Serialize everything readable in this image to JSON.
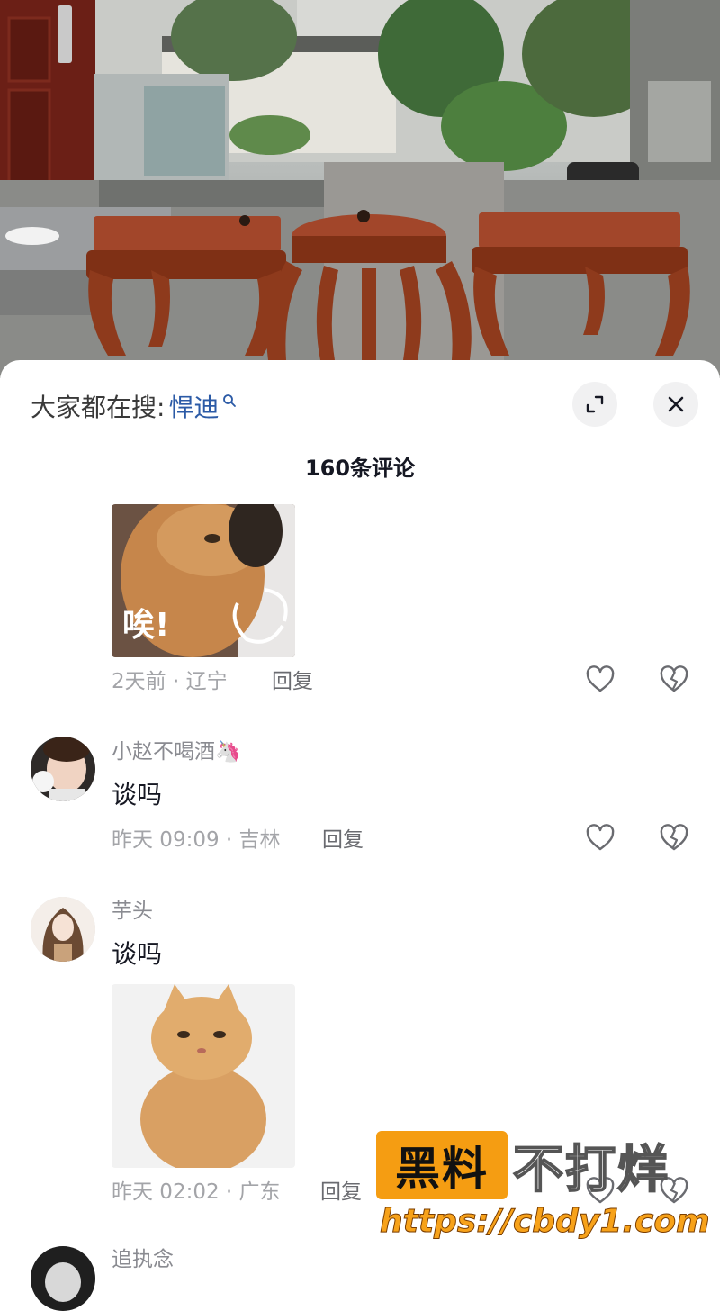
{
  "header": {
    "search_prefix": "大家都在搜:",
    "search_term": "悍迪",
    "comment_count": "160条评论"
  },
  "comments": [
    {
      "sticker_caption": "唉!",
      "meta": "2天前 · 辽宁",
      "reply_label": "回复"
    },
    {
      "username": "小赵不喝酒🦄",
      "text": "谈吗",
      "meta": "昨天 09:09 · 吉林",
      "reply_label": "回复"
    },
    {
      "username": "芋头",
      "text": "谈吗",
      "meta": "昨天 02:02 · 广东",
      "reply_label": "回复"
    },
    {
      "username": "追执念"
    }
  ],
  "watermark": {
    "black_text": "黑料",
    "white_text": "不打烊",
    "url": "https://cbdy1.com"
  },
  "colors": {
    "search_term": "#2b5aa6",
    "watermark_orange": "#f59d12",
    "wood": "#8e3a1c"
  }
}
